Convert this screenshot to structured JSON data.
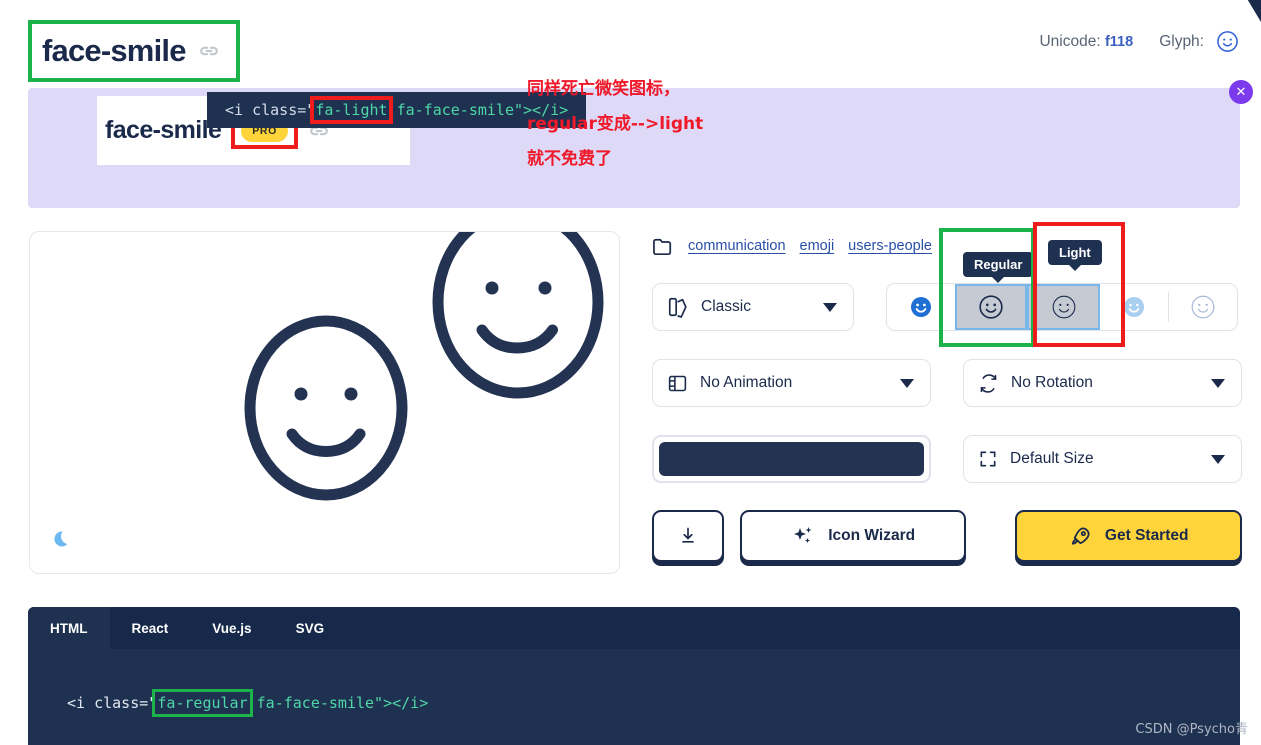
{
  "header": {
    "icon_name": "face-smile",
    "link_icon": "link-icon",
    "unicode_label": "Unicode:",
    "unicode_value": "f118",
    "glyph_label": "Glyph:",
    "glyph_icon": "smiley-face-icon"
  },
  "promo": {
    "icon_name": "face-smile",
    "pro_badge": "PRO",
    "link_icon": "link-icon",
    "code_prefix": "<i class=\"",
    "code_highlight": "fa-light",
    "code_suffix": " fa-face-smile\"></i>",
    "close_label": "✕",
    "annotation_lines": [
      "同样死亡微笑图标，",
      "regular变成-->light",
      "就不免费了"
    ],
    "annotation_color": "#f0192a"
  },
  "preview": {
    "moon_icon": "moon-icon",
    "face_color": "#233351"
  },
  "categories": {
    "folder_icon": "folder-icon",
    "items": [
      "communication",
      "emoji",
      "users-people"
    ]
  },
  "controls": {
    "family": {
      "label": "Classic",
      "icon": "palette-icon"
    },
    "animation": {
      "label": "No Animation",
      "icon": "film-icon"
    },
    "rotation": {
      "label": "No Rotation",
      "icon": "rotate-icon"
    },
    "size": {
      "label": "Default Size",
      "icon": "expand-icon"
    },
    "color": {
      "value": "#233351",
      "name": "color-swatch"
    }
  },
  "styles": {
    "tooltip_regular": "Regular",
    "tooltip_light": "Light",
    "options": [
      {
        "name": "solid",
        "selected": false
      },
      {
        "name": "regular",
        "selected": true
      },
      {
        "name": "light",
        "selected": true
      },
      {
        "name": "thin",
        "selected": false
      },
      {
        "name": "duotone",
        "selected": false
      }
    ]
  },
  "actions": {
    "download": {
      "label": "",
      "icon": "download-icon"
    },
    "wizard": {
      "label": "Icon Wizard",
      "icon": "sparkles-icon"
    },
    "get_started": {
      "label": "Get Started",
      "icon": "rocket-icon",
      "color": "#ffd43b"
    }
  },
  "code_panel": {
    "tabs": [
      "HTML",
      "React",
      "Vue.js",
      "SVG"
    ],
    "active_tab": "HTML",
    "code_prefix": "<i class=\"",
    "code_highlight": "fa-regular",
    "code_suffix": " fa-face-smile\"></i>"
  },
  "watermark": "CSDN @Psycho青"
}
